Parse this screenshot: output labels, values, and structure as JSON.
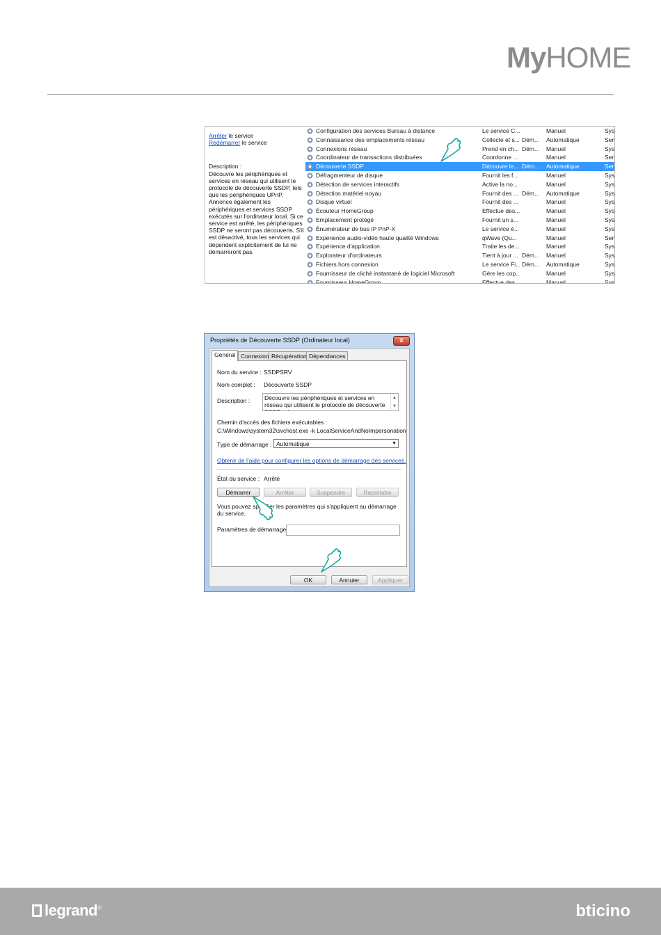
{
  "header": {
    "brand_my": "My",
    "brand_home": "HOME"
  },
  "services": {
    "left": {
      "stop_link": "Arrêter",
      "stop_suffix": " le service",
      "restart_link": "Redémarrer",
      "restart_suffix": " le service",
      "description_title": "Description :",
      "description_text": "Découvre les périphériques et services en réseau qui utilisent le protocole de découverte SSDP, tels que les périphériques UPnP. Annonce également les périphériques et services SSDP exécutés sur l'ordinateur local. Si ce service est arrêté, les périphériques SSDP ne seront pas découverts. S'il est désactivé, tous les services qui dépendent explicitement de lui ne démarreront pas."
    },
    "rows": [
      {
        "name": "Configuration des services Bureau à distance",
        "desc": "Le service C...",
        "state": "",
        "type": "Manuel",
        "log": "Syst"
      },
      {
        "name": "Connaissance des emplacements réseau",
        "desc": "Collecte et s...",
        "state": "Dém...",
        "type": "Automatique",
        "log": "Serv"
      },
      {
        "name": "Connexions réseau",
        "desc": "Prend en ch...",
        "state": "Dém...",
        "type": "Manuel",
        "log": "Syst"
      },
      {
        "name": "Coordinateur de transactions distribuées",
        "desc": "Coordonne ...",
        "state": "",
        "type": "Manuel",
        "log": "Serv"
      },
      {
        "name": "Découverte SSDP",
        "desc": "Découvre le...",
        "state": "Dém...",
        "type": "Automatique",
        "log": "Serv",
        "selected": true
      },
      {
        "name": "Défragmenteur de disque",
        "desc": "Fournit les f...",
        "state": "",
        "type": "Manuel",
        "log": "Syst"
      },
      {
        "name": "Détection de services interactifs",
        "desc": "Active la no...",
        "state": "",
        "type": "Manuel",
        "log": "Syst"
      },
      {
        "name": "Détection matériel noyau",
        "desc": "Fournit des ...",
        "state": "Dém...",
        "type": "Automatique",
        "log": "Syst"
      },
      {
        "name": "Disque virtuel",
        "desc": "Fournit des ...",
        "state": "",
        "type": "Manuel",
        "log": "Syst"
      },
      {
        "name": "Écouteur HomeGroup",
        "desc": "Effectue des...",
        "state": "",
        "type": "Manuel",
        "log": "Syst"
      },
      {
        "name": "Emplacement protégé",
        "desc": "Fournit un s...",
        "state": "",
        "type": "Manuel",
        "log": "Syst"
      },
      {
        "name": "Énumérateur de bus IP PnP-X",
        "desc": "Le service é...",
        "state": "",
        "type": "Manuel",
        "log": "Syst"
      },
      {
        "name": "Expérience audio-vidéo haute qualité Windows",
        "desc": "qWave (Qu...",
        "state": "",
        "type": "Manuel",
        "log": "Serv"
      },
      {
        "name": "Expérience d'application",
        "desc": "Traite les de...",
        "state": "",
        "type": "Manuel",
        "log": "Syst"
      },
      {
        "name": "Explorateur d'ordinateurs",
        "desc": "Tient à jour ...",
        "state": "Dém...",
        "type": "Manuel",
        "log": "Syst"
      },
      {
        "name": "Fichiers hors connexion",
        "desc": "Le service Fi...",
        "state": "Dém...",
        "type": "Automatique",
        "log": "Syst"
      },
      {
        "name": "Fournisseur de cliché instantané de logiciel Microsoft",
        "desc": "Gère les cop...",
        "state": "",
        "type": "Manuel",
        "log": "Syst"
      },
      {
        "name": "Fournisseur HomeGroup",
        "desc": "Effectue des...",
        "state": "",
        "type": "Manuel",
        "log": "Syst"
      }
    ]
  },
  "dialog": {
    "title": "Propriétés de Découverte SSDP (Ordinateur local)",
    "close": "x",
    "tabs": [
      "Général",
      "Connexion",
      "Récupération",
      "Dépendances"
    ],
    "service_name_label": "Nom du service :",
    "service_name": "SSDPSRV",
    "display_name_label": "Nom complet :",
    "display_name": "Découverte SSDP",
    "description_label": "Description :",
    "description": "Découvre les périphériques et services en réseau qui utilisent le protocole de découverte SSDP, tels",
    "path_label": "Chemin d'accès des fichiers exécutables :",
    "path": "C:\\Windows\\system32\\svchost.exe -k LocalServiceAndNoImpersonation",
    "startup_type_label": "Type de démarrage :",
    "startup_type": "Automatique",
    "help_link": "Obtenir de l'aide pour configurer les options de démarrage des services.",
    "status_label": "État du service :",
    "status": "Arrêté",
    "btn_start": "Démarrer",
    "btn_stop": "Arrêter",
    "btn_pause": "Suspendre",
    "btn_resume": "Reprendre",
    "hint": "Vous pouvez spécifier les paramètres qui s'appliquent au démarrage du service.",
    "params_label": "Paramètres de démarrage :",
    "btn_ok": "OK",
    "btn_cancel": "Annuler",
    "btn_apply": "Appliquer"
  },
  "footer": {
    "left_logo": "legrand",
    "left_mark": "®",
    "right_logo": "bticino"
  }
}
